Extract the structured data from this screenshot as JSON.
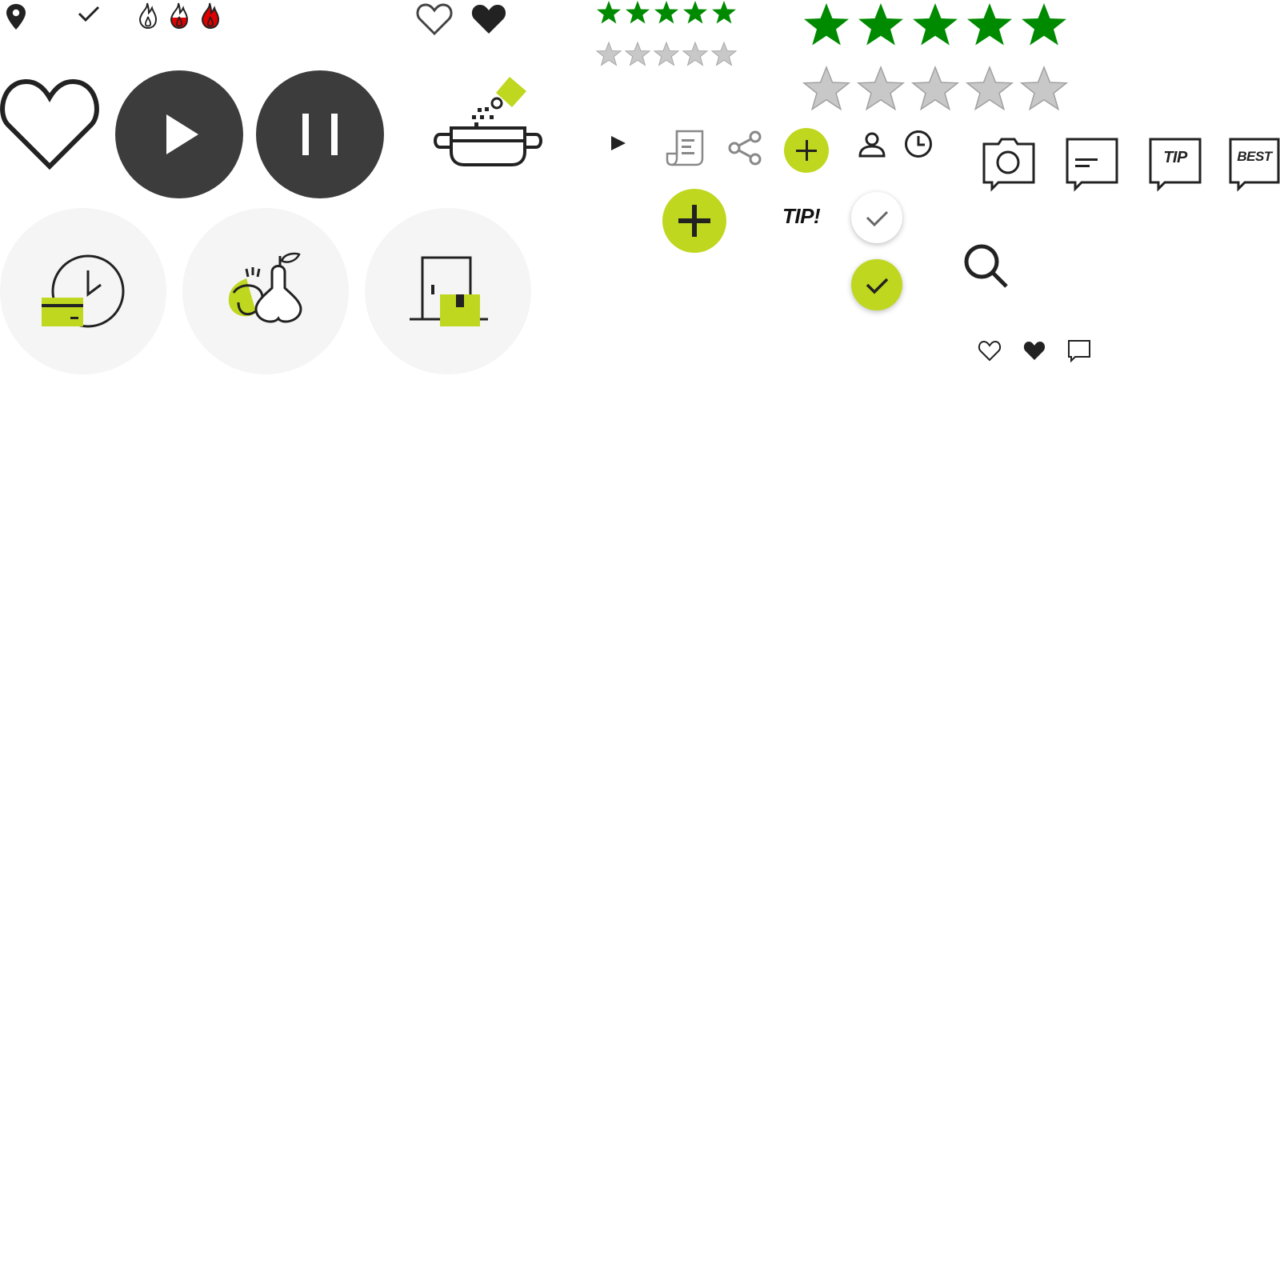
{
  "colors": {
    "lime": "#BFD71E",
    "dark": "#222222",
    "circle_dark": "#3C3C3C",
    "star_green": "#008A00",
    "star_gray": "#C8C8C8",
    "flame_red": "#E00000",
    "tile_bg": "#F5F5F5"
  },
  "icons": [
    "location-pin-icon",
    "check-icon",
    "flame-empty-icon",
    "flame-half-icon",
    "flame-full-icon",
    "heart-outline-icon",
    "heart-filled-icon",
    "play-button-icon",
    "pause-button-icon",
    "seasoning-pot-icon",
    "arrow-right-icon",
    "recipe-scroll-icon",
    "share-icon",
    "add-button-icon",
    "user-icon",
    "clock-icon",
    "camera-comment-icon",
    "comment-icon",
    "tip-comment-icon",
    "best-comment-icon",
    "search-icon",
    "time-cost-icon",
    "fruit-icon",
    "delivery-door-icon"
  ],
  "ratings": {
    "small_filled": 5,
    "small_empty": 5,
    "large_filled": 5,
    "large_empty": 5
  },
  "labels": {
    "tip_bubble": "TIP",
    "best_bubble": "BEST",
    "tip_badge": "TIP!"
  }
}
